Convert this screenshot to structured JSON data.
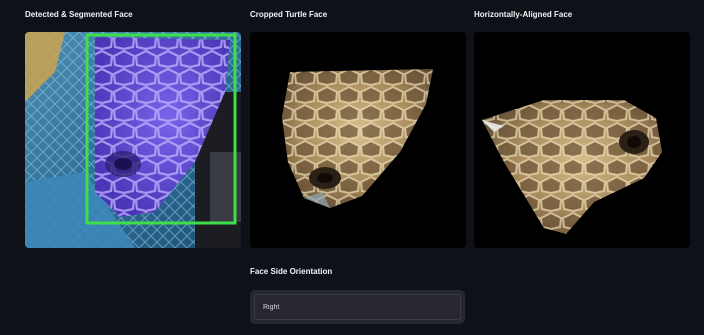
{
  "columns": {
    "detected": {
      "title": "Detected & Segmented Face"
    },
    "cropped": {
      "title": "Cropped Turtle Face"
    },
    "aligned": {
      "title": "Horizontally-Aligned Face"
    }
  },
  "orientation": {
    "label": "Face Side Orientation",
    "value": "Right"
  },
  "colors": {
    "background": "#0e1117",
    "bounding_box": "#3ee04a",
    "segmentation_mask": "#6a4fe0",
    "input_background": "#262730"
  },
  "icons": {
    "bounding_box": "detection-box-icon"
  }
}
